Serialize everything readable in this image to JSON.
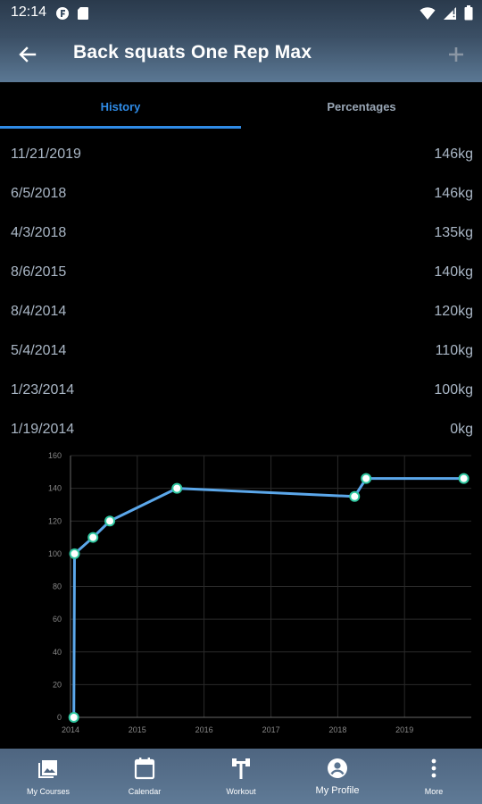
{
  "status_bar": {
    "time": "12:14"
  },
  "app_bar": {
    "title": "Back squats One Rep Max"
  },
  "tabs": [
    {
      "label": "History",
      "active": true
    },
    {
      "label": "Percentages",
      "active": false
    }
  ],
  "history": [
    {
      "date": "11/21/2019",
      "value": "146kg"
    },
    {
      "date": "6/5/2018",
      "value": "146kg"
    },
    {
      "date": "4/3/2018",
      "value": "135kg"
    },
    {
      "date": "8/6/2015",
      "value": "140kg"
    },
    {
      "date": "8/4/2014",
      "value": "120kg"
    },
    {
      "date": "5/4/2014",
      "value": "110kg"
    },
    {
      "date": "1/23/2014",
      "value": "100kg"
    },
    {
      "date": "1/19/2014",
      "value": "0kg"
    }
  ],
  "chart_data": {
    "type": "line",
    "x": [
      "2014-01-19",
      "2014-01-23",
      "2014-05-04",
      "2014-08-04",
      "2015-08-06",
      "2018-04-03",
      "2018-06-05",
      "2019-11-21"
    ],
    "series": [
      {
        "values": [
          0,
          100,
          110,
          120,
          140,
          135,
          146,
          146
        ]
      }
    ],
    "x_ticks": [
      "2014",
      "2015",
      "2016",
      "2017",
      "2018",
      "2019"
    ],
    "y_ticks": [
      "0",
      "20",
      "40",
      "60",
      "80",
      "100",
      "120",
      "140",
      "160"
    ],
    "ylim": [
      0,
      160
    ],
    "xlim": [
      "2014-01-01",
      "2020-01-01"
    ],
    "grid": true,
    "colors": {
      "line": "#5ba7ea",
      "marker_fill": "#ffffff",
      "marker_edge": "#2fc7a0",
      "grid": "#2a2a2a"
    }
  },
  "bottom_nav": [
    {
      "label": "My Courses",
      "icon": "image-icon",
      "active": false
    },
    {
      "label": "Calendar",
      "icon": "calendar-icon",
      "active": false
    },
    {
      "label": "Workout",
      "icon": "workout-icon",
      "active": false
    },
    {
      "label": "My Profile",
      "icon": "profile-icon",
      "active": true
    },
    {
      "label": "More",
      "icon": "more-vertical-icon",
      "active": false
    }
  ],
  "colors": {
    "accent": "#2f8be6",
    "header": "#3b4f65",
    "background": "#000000",
    "muted_text": "#aab7c6"
  }
}
